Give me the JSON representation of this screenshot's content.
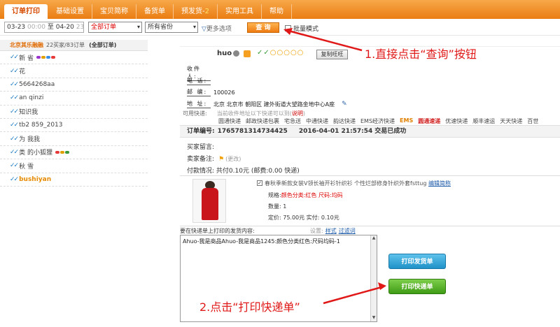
{
  "nav": {
    "tabs": [
      {
        "label": "订单打印",
        "active": true
      },
      {
        "label": "基础设置"
      },
      {
        "label": "宝贝简称"
      },
      {
        "label": "备货单"
      },
      {
        "label": "预发货-",
        "badge": "2"
      },
      {
        "label": "实用工具"
      },
      {
        "label": "帮助"
      }
    ]
  },
  "filter": {
    "date_start": "03-23",
    "time_start": "00:00",
    "date_sep": "至",
    "date_end": "04-20",
    "time_end": "23:59",
    "order_filter": "全部订单",
    "province_filter": "所有省份",
    "more_options": "更多选项",
    "query_button": "查 询",
    "batch_mode": "批量模式"
  },
  "sidebar": {
    "header": {
      "store": "北京其乐融融",
      "counts": "22买家/83订单",
      "all": "(全部订单)"
    },
    "items": [
      {
        "name": "新 省",
        "flags": [
          "#9b33cc",
          "#e0a000",
          "#3a8ee6",
          "#e63a3a"
        ]
      },
      {
        "name": "花",
        "flags": []
      },
      {
        "name": "5664268aa",
        "flags": []
      },
      {
        "name": "an qinzi",
        "flags": []
      },
      {
        "name": "知识我 ",
        "flags": []
      },
      {
        "name": "tb2 859_2013",
        "flags": []
      },
      {
        "name": "为 我我",
        "flags": []
      },
      {
        "name": "类 的小狐狸",
        "flags": [
          "#e63a3a",
          "#e0a000",
          "#3a9a3a"
        ]
      },
      {
        "name": "秋 雪",
        "flags": []
      },
      {
        "name": "bushiyan ",
        "flags": [],
        "active": true
      }
    ]
  },
  "buyer": {
    "name": "huo",
    "stars": "✓✓",
    "circles": "○○○○○",
    "copy_button": "复制旺旺",
    "fields": [
      {
        "label": "收件人:",
        "value": ""
      },
      {
        "label": "电 话:",
        "value": ""
      },
      {
        "label": "邮 编:",
        "value": "100026"
      },
      {
        "label": "地 址:",
        "value": "北京 北京市 朝阳区 建外街道大望路金地中心A座"
      }
    ]
  },
  "shipping": {
    "label": "可用快递:",
    "note": "当前收件地址以下快递可以到(",
    "note_link": "说明",
    "note_end": ")",
    "carriers": [
      "圆通快递",
      "邮政快递包裹",
      "宅急送",
      "中通快递",
      "韵达快递",
      "EMS经济快递",
      "EMS",
      "圆通速递",
      "优速快递",
      "顺丰速运",
      "天天快递",
      "百世"
    ]
  },
  "order": {
    "label": "订单编号:",
    "number": "1765781314734425",
    "time": "2016-04-01 21:57:54",
    "status": "交易已成功"
  },
  "messages": {
    "buyer_msg_label": "买家留言:",
    "seller_note_label": "卖家备注:",
    "change": "(更改)",
    "payment_label": "付款情况:",
    "payment": "共付0.10元 (邮费:0.00  快递)"
  },
  "product": {
    "title": "春秋季新款女装V领长袖开衫针织衫 个性烂部修身针织外套fsttug",
    "edit_link": "编辑简称",
    "spec_label": "规格:",
    "spec_value": "颜色分类:红色 尺码:均码",
    "qty_label": "数量:",
    "qty": "1",
    "price": "定价: 75.00元  实付: 0.10元"
  },
  "print": {
    "label": "要在快递单上打印的发货内容:",
    "settings": "设置:",
    "style_link": "样式",
    "filter_link": "过滤词",
    "content": "Ahuo-我是商品Ahuo-我是商品1245:颜色分类红色:尺码均码-1",
    "btn_delivery": "打印发货单",
    "btn_express": "打印快递单"
  },
  "annotations": {
    "step1": "1.直接点击“查询”按钮",
    "step2": "2.点击“打印快递单”"
  }
}
